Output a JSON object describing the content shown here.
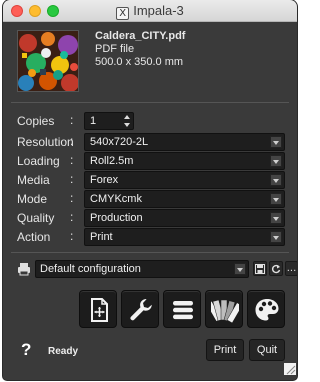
{
  "window": {
    "title": "Impala-3",
    "x_glyph": "X"
  },
  "file": {
    "name": "Caldera_CITY.pdf",
    "type": "PDF file",
    "size": "500.0 x 350.0 mm"
  },
  "settings": {
    "separator": ":",
    "copies": {
      "label": "Copies",
      "value": "1"
    },
    "resolution": {
      "label": "Resolution",
      "value": "540x720-2L"
    },
    "loading": {
      "label": "Loading",
      "value": "Roll2.5m"
    },
    "media": {
      "label": "Media",
      "value": "Forex"
    },
    "mode": {
      "label": "Mode",
      "value": "CMYKcmk"
    },
    "quality": {
      "label": "Quality",
      "value": "Production"
    },
    "action": {
      "label": "Action",
      "value": "Print"
    }
  },
  "configuration": {
    "value": "Default configuration",
    "more_label": "..."
  },
  "toolbar": {
    "icons": [
      "document-add-icon",
      "wrench-icon",
      "list-icon",
      "color-swatch-icon",
      "palette-icon"
    ]
  },
  "footer": {
    "help_label": "?",
    "status": "Ready",
    "print_label": "Print",
    "quit_label": "Quit"
  },
  "colors": {
    "window_bg": "#3a3a3a",
    "field_bg": "#1e1e1e",
    "text": "#e6e6e6"
  }
}
